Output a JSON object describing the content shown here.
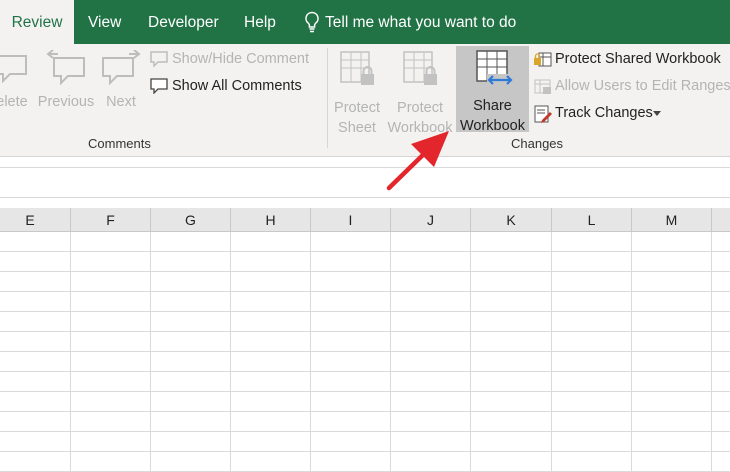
{
  "tabs": [
    {
      "label": "Review",
      "active": true
    },
    {
      "label": "View",
      "active": false
    },
    {
      "label": "Developer",
      "active": false
    },
    {
      "label": "Help",
      "active": false
    }
  ],
  "tell_me": "Tell me what you want to do",
  "comments": {
    "delete": "elete",
    "previous": "Previous",
    "next": "Next",
    "show_hide": "Show/Hide Comment",
    "show_all": "Show All Comments",
    "group_label": "Comments"
  },
  "changes": {
    "protect_sheet": [
      "Protect",
      "Sheet"
    ],
    "protect_workbook": [
      "Protect",
      "Workbook"
    ],
    "share_workbook": [
      "Share",
      "Workbook"
    ],
    "protect_shared": "Protect Shared Workbook",
    "allow_users": "Allow Users to Edit Ranges",
    "track_changes": "Track Changes",
    "group_label": "Changes"
  },
  "columns": [
    "E",
    "F",
    "G",
    "H",
    "I",
    "J",
    "K",
    "L",
    "M"
  ],
  "colors": {
    "brand": "#217346",
    "arrow": "#e3262b",
    "highlight": "#c6c6c6"
  }
}
